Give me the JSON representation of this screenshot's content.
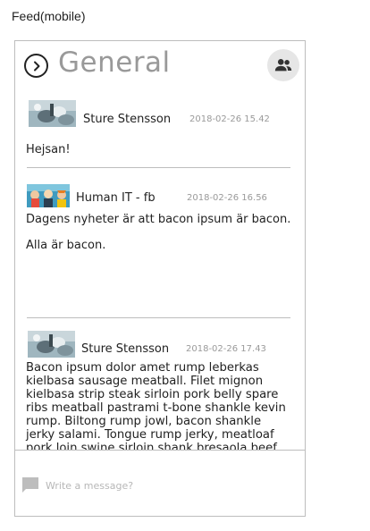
{
  "caption": "Feed(mobile)",
  "header": {
    "title": "General",
    "back_icon": "chevron-right-icon",
    "members_icon": "people-icon"
  },
  "posts": [
    {
      "author": "Sture Stensson",
      "time": "2018-02-26 15.42",
      "paragraphs": [
        "Hejsan!"
      ],
      "avatar": "photo-avatar"
    },
    {
      "author": "Human IT - fb",
      "time": "2018-02-26 16.56",
      "paragraphs": [
        "Dagens nyheter är att bacon ipsum är bacon.",
        "Alla är bacon."
      ],
      "avatar": "illustration-avatar"
    },
    {
      "author": "Sture Stensson",
      "time": "2018-02-26 17.43",
      "paragraphs": [
        "Bacon ipsum dolor amet rump leberkas kielbasa sausage meatball. Filet mignon kielbasa strip steak sirloin pork belly spare ribs meatball pastrami t-bone shankle kevin rump. Biltong rump jowl, bacon shankle jerky salami. Tongue rump jerky, meatloaf pork loin swine sirloin shank bresaola beef ribs. Salami kevin buffalo pork belly."
      ],
      "avatar": "photo-avatar"
    }
  ],
  "composer": {
    "placeholder": "Write a message?",
    "icon": "message-icon"
  },
  "colors": {
    "title": "#999999",
    "timestamp": "#9a9a9a",
    "border": "#bdbdbd",
    "members_bg": "#e6e6e6"
  }
}
